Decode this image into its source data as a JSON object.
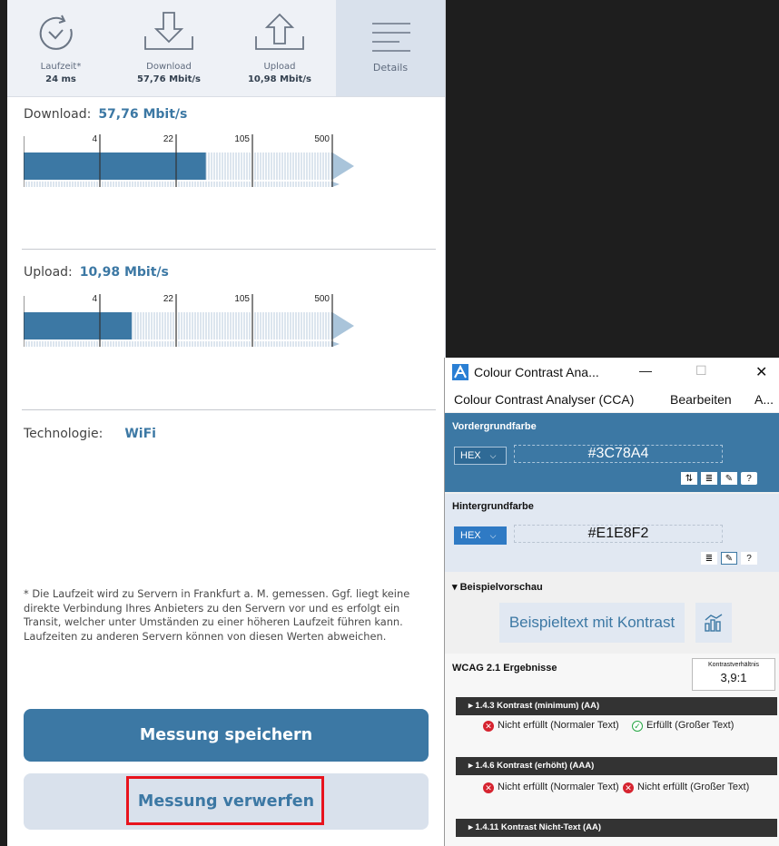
{
  "app": {
    "tabs": [
      {
        "label": "Laufzeit*",
        "value": "24 ms",
        "icon": "clock-refresh-icon"
      },
      {
        "label": "Download",
        "value": "57,76 Mbit/s",
        "icon": "download-arrow-icon"
      },
      {
        "label": "Upload",
        "value": "10,98 Mbit/s",
        "icon": "upload-arrow-icon"
      },
      {
        "label": "Details",
        "value": "",
        "icon": "menu-lines-icon",
        "active": true
      }
    ],
    "download": {
      "title": "Download:",
      "value": "57,76 Mbit/s",
      "scale_labels": [
        "4",
        "22",
        "105",
        "500"
      ],
      "fill_fraction": 0.59
    },
    "upload": {
      "title": "Upload:",
      "value": "10,98 Mbit/s",
      "scale_labels": [
        "4",
        "22",
        "105",
        "500"
      ],
      "fill_fraction": 0.35
    },
    "technology": {
      "label": "Technologie:",
      "value": "WiFi"
    },
    "note": "* Die Laufzeit wird zu Servern in Frankfurt a. M. gemessen. Ggf. liegt keine direkte Verbindung Ihres Anbieters zu den Servern vor und es erfolgt ein Transit, welcher unter Umständen zu einer höheren Laufzeit führen kann. Laufzeiten zu anderen Servern können von diesen Werten abweichen.",
    "save_button": "Messung speichern",
    "discard_button": "Messung verwerfen",
    "colors": {
      "accent": "#3c78a4",
      "highlight": "#e8131d"
    }
  },
  "cca": {
    "window_title": "Colour Contrast Ana...",
    "window_controls": {
      "minimize": "—",
      "maximize": "☐",
      "close": "✕"
    },
    "menu": {
      "app": "Colour Contrast Analyser (CCA)",
      "edit": "Bearbeiten",
      "more": "A..."
    },
    "foreground": {
      "label": "Vordergrundfarbe",
      "format": "HEX",
      "value": "#3C78A4"
    },
    "background": {
      "label": "Hintergrundfarbe",
      "format": "HEX",
      "value": "#E1E8F2"
    },
    "preview": {
      "label": "▾ Beispielvorschau",
      "text": "Beispieltext mit Kontrast"
    },
    "wcag": {
      "title": "WCAG 2.1 Ergebnisse",
      "ratio_label": "Kontrastverhältnis",
      "ratio_value": "3,9:1",
      "criteria": [
        {
          "title": "▸ 1.4.3 Kontrast (minimum) (AA)",
          "normal": "Nicht erfüllt (Normaler Text)",
          "large": "Erfüllt (Großer Text)",
          "normal_pass": false,
          "large_pass": true
        },
        {
          "title": "▸ 1.4.6 Kontrast (erhöht) (AAA)",
          "normal": "Nicht erfüllt (Normaler Text)",
          "large": "Nicht erfüllt (Großer Text)",
          "normal_pass": false,
          "large_pass": false
        },
        {
          "title": "▸ 1.4.11 Kontrast Nicht-Text (AA)"
        }
      ]
    }
  }
}
